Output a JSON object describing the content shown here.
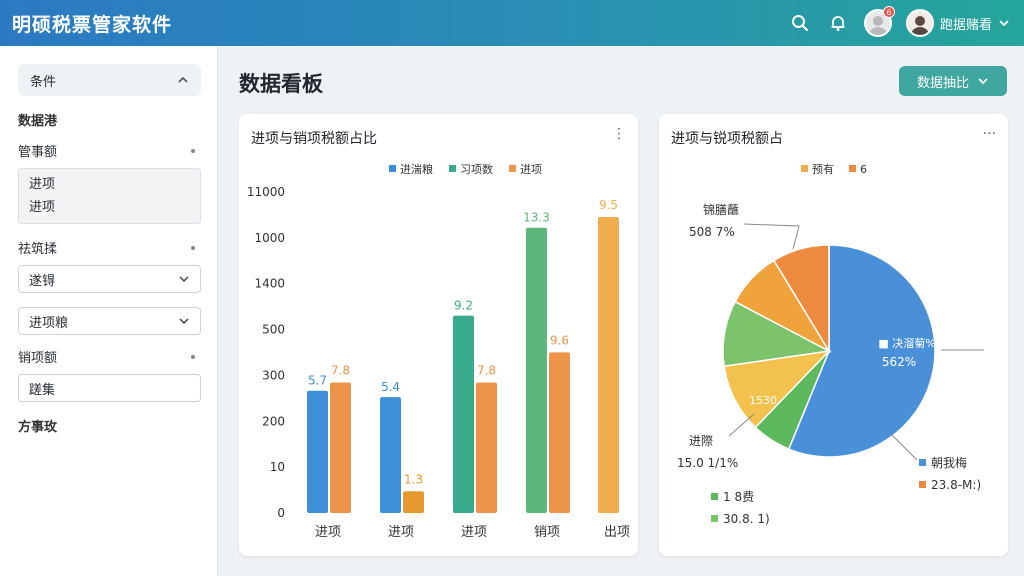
{
  "app": {
    "title": "明硕税票管家软件"
  },
  "header": {
    "username": "跑据赌看",
    "badge_count": "6"
  },
  "sidebar": {
    "filter_title": "条件",
    "section_title": "数据港",
    "group1_label": "管事额",
    "group1_items": [
      "进项",
      "进项"
    ],
    "group2_label": "祛筑揉",
    "group2_select": "遂锝",
    "group3_select": "进项粮",
    "group4_label": "销项额",
    "group4_input": "蹉集",
    "footer_label": "方事玫"
  },
  "page": {
    "title": "数据看板",
    "export_label": "数据抽比"
  },
  "bar_card": {
    "title": "进项与销项税额占比"
  },
  "pie_card": {
    "title": "进项与锐项税额占"
  },
  "chart_data": [
    {
      "type": "bar",
      "title": "进项与销项税额占比",
      "categories": [
        "进项",
        "进项",
        "进项",
        "销项",
        "出项"
      ],
      "y_ticks": [
        "0",
        "10",
        "200",
        "300",
        "500",
        "1400",
        "1000",
        "11000"
      ],
      "series": [
        {
          "name": "进湍粮",
          "color": "#3d8fd8",
          "values": [
            5.7,
            5.4,
            null,
            null,
            null
          ],
          "labels": [
            "5.7",
            "5.4",
            "",
            "",
            ""
          ]
        },
        {
          "name": "习项数",
          "color": "#3aaa8c",
          "values": [
            null,
            null,
            9.2,
            13.3,
            null
          ],
          "labels": [
            "",
            "",
            "9.2",
            "13.3",
            ""
          ]
        },
        {
          "name": "进项",
          "color": "#ec9449",
          "values": [
            7.8,
            1.3,
            7.8,
            9.6,
            9.5
          ],
          "labels": [
            "7.8",
            "1.3",
            "7.8",
            "9.6",
            "9.5"
          ]
        }
      ],
      "bar_colors": [
        [
          "#3d8fd8",
          "#ec9449"
        ],
        [
          "#3d8fd8",
          "#e69a2e"
        ],
        [
          "#3aaa8c",
          "#ec9449"
        ],
        [
          "#5cb87a",
          "#ec9449"
        ],
        [
          null,
          "#f0ad4e"
        ]
      ]
    },
    {
      "type": "pie",
      "title": "进项与锐项税额占",
      "legend_top": [
        {
          "label": "预有",
          "color": "#f0ad4e"
        },
        {
          "label": "6",
          "color": "#ec8a3f"
        }
      ],
      "slices": [
        {
          "label": "决溜菊%",
          "value": 56.2,
          "display": "562%",
          "color": "#4a90d9"
        },
        {
          "label": "",
          "value": 6.0,
          "color": "#5cb85c"
        },
        {
          "label": "1530",
          "value": 10.5,
          "display": "1530",
          "color": "#f2c14e"
        },
        {
          "label": "",
          "value": 10.0,
          "color": "#7cc46b"
        },
        {
          "label": "",
          "value": 8.6,
          "color": "#f0a23c"
        },
        {
          "label": "",
          "value": 8.7,
          "color": "#ec8a3f"
        }
      ],
      "callouts": [
        {
          "label": "锦膳蘸",
          "value": "508 7%"
        },
        {
          "label": "进際",
          "value": "15.0 1/1%"
        }
      ],
      "legend_bottom": [
        {
          "label": "朝我梅",
          "color": "#4a90d9"
        },
        {
          "label": "23.8-M:)",
          "color": "#ec8a3f"
        },
        {
          "label": "1 8费",
          "color": "#5cb85c"
        },
        {
          "label": "30.8. 1)",
          "color": "#7cc46b"
        }
      ]
    }
  ]
}
